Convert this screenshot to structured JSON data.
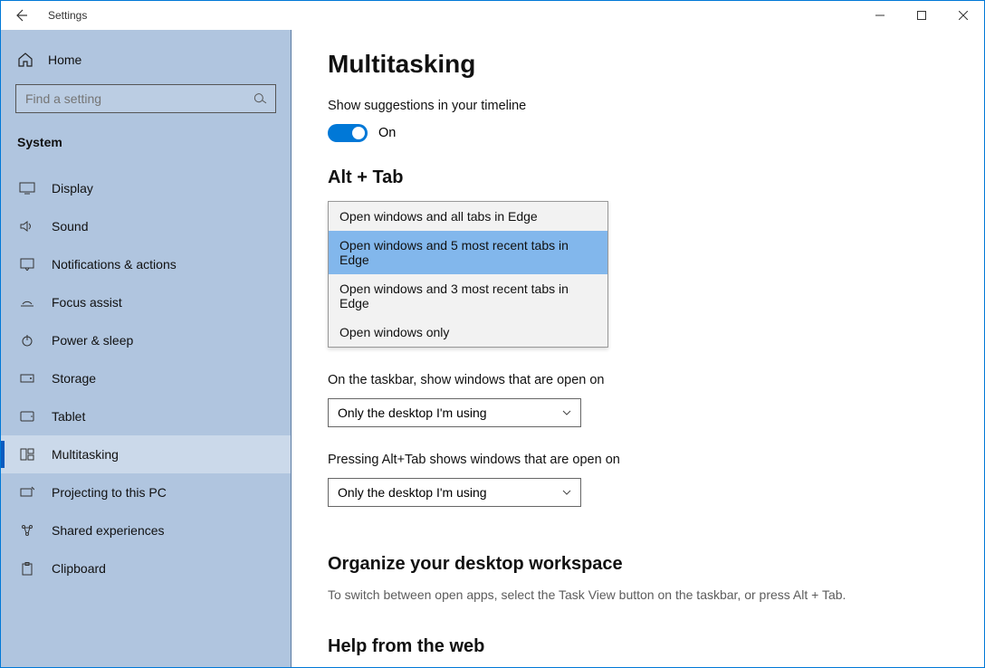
{
  "titlebar": {
    "title": "Settings"
  },
  "sidebar": {
    "home": "Home",
    "search_placeholder": "Find a setting",
    "category": "System",
    "items": [
      {
        "label": "Display"
      },
      {
        "label": "Sound"
      },
      {
        "label": "Notifications & actions"
      },
      {
        "label": "Focus assist"
      },
      {
        "label": "Power & sleep"
      },
      {
        "label": "Storage"
      },
      {
        "label": "Tablet"
      },
      {
        "label": "Multitasking"
      },
      {
        "label": "Projecting to this PC"
      },
      {
        "label": "Shared experiences"
      },
      {
        "label": "Clipboard"
      }
    ]
  },
  "main": {
    "title": "Multitasking",
    "timeline_label": "Show suggestions in your timeline",
    "toggle_state": "On",
    "alt_tab_heading": "Alt + Tab",
    "alt_tab_options": [
      "Open windows and all tabs in Edge",
      "Open windows and 5 most recent tabs in Edge",
      "Open windows and 3 most recent tabs in Edge",
      "Open windows only"
    ],
    "taskbar_label": "On the taskbar, show windows that are open on",
    "taskbar_value": "Only the desktop I'm using",
    "alttab_label": "Pressing Alt+Tab shows windows that are open on",
    "alttab_value": "Only the desktop I'm using",
    "organize_heading": "Organize your desktop workspace",
    "organize_desc": "To switch between open apps, select the Task View button on the taskbar, or press Alt + Tab.",
    "help_heading": "Help from the web"
  }
}
